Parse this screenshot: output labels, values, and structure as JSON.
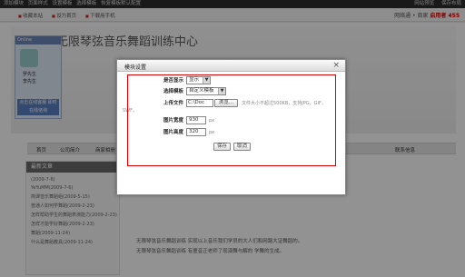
{
  "adminbar": {
    "items": [
      "添加模块",
      "页面样式",
      "设置模板",
      "选择模板",
      "恢复模板默认配置"
    ],
    "right": [
      "网站预览",
      "保存布局"
    ]
  },
  "topstrip": {
    "links": [
      "收藏本站",
      "设为首页",
      "下载用手机"
    ],
    "brand": "网络通 • 商家",
    "brand_suffix": "启用者 455"
  },
  "site": {
    "title": "无限琴弦音乐舞蹈训练中心",
    "online_header": "Online",
    "online_rows": [
      "罗先生",
      "李先生"
    ],
    "online_cta": "点击在线客服 即时在线谘询",
    "nav": [
      "首页",
      "公司简介",
      "商家相册"
    ],
    "nav_right": "联系信息",
    "sidebar_title": "最新文章",
    "sidebar_items": [
      "(2009-7-6)",
      "YeYuMM(2009-7-6)",
      "简课音乐舞蹈组(2009-5-15)",
      "普通人如何学舞蹈(2009-2-23)",
      "怎样帮助学生的舞蹈表演能力(2009-2-23)",
      "怎样才能学好舞蹈(2009-2-23)",
      "舞蹈(2009-11-24)",
      "什么是舞蹈教具(2009-11-24)"
    ],
    "article_lines": [
      "无限琴弦音乐舞蹈训练 实现以上音乐我们学员的大人们和网路大证舞蹈的。",
      "无限琴弦音乐舞蹈训练 有童音正老师了现演舞与解的 学舞的生成。"
    ]
  },
  "dialog": {
    "title": "模块设置",
    "close": "×",
    "fields": {
      "show_label": "是否显示",
      "show_value": "显示",
      "template_label": "选择模板",
      "template_value": "自定义模板",
      "upload_label": "上传文件",
      "upload_value": "C:\\Doc",
      "browse": "浏览...",
      "upload_hint": "文件大小不超过500KB，支持JPG，GIF，",
      "upload_hint2": "SWF。",
      "width_label": "图片宽度",
      "width_value": "930",
      "height_label": "图片高度",
      "height_value": "320",
      "unit": "px"
    },
    "save": "保存",
    "cancel": "取消"
  }
}
